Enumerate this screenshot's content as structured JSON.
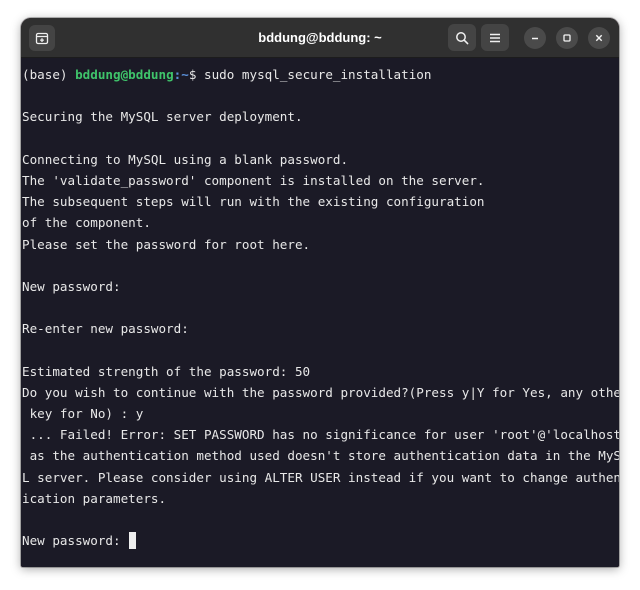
{
  "window": {
    "title": "bddung@bddung: ~"
  },
  "titlebar": {
    "new_tab_icon": "new-tab-icon",
    "search_icon": "search-icon",
    "menu_icon": "hamburger-menu-icon",
    "minimize_icon": "minimize-icon",
    "maximize_icon": "maximize-icon",
    "close_icon": "close-icon",
    "minimize_glyph": "–",
    "maximize_glyph": "▢",
    "close_glyph": "✕"
  },
  "colors": {
    "terminal_background": "#1b1a26",
    "titlebar_background": "#303030",
    "prompt_user_color": "#3fc46b",
    "prompt_path_color": "#5a8fd8",
    "text_color": "#e8e8e8"
  },
  "terminal": {
    "prompt": {
      "env": "(base) ",
      "user_host": "bddung@bddung",
      "path": ":~",
      "symbol": "$ ",
      "command": "sudo mysql_secure_installation"
    },
    "lines": [
      "",
      "Securing the MySQL server deployment.",
      "",
      "Connecting to MySQL using a blank password.",
      "The 'validate_password' component is installed on the server.",
      "The subsequent steps will run with the existing configuration",
      "of the component.",
      "Please set the password for root here.",
      "",
      "New password:",
      "",
      "Re-enter new password:",
      "",
      "Estimated strength of the password: 50",
      "Do you wish to continue with the password provided?(Press y|Y for Yes, any other",
      " key for No) : y",
      " ... Failed! Error: SET PASSWORD has no significance for user 'root'@'localhost'",
      " as the authentication method used doesn't store authentication data in the MySQ",
      "L server. Please consider using ALTER USER instead if you want to change authent",
      "ication parameters.",
      ""
    ],
    "current_prompt": "New password: "
  }
}
